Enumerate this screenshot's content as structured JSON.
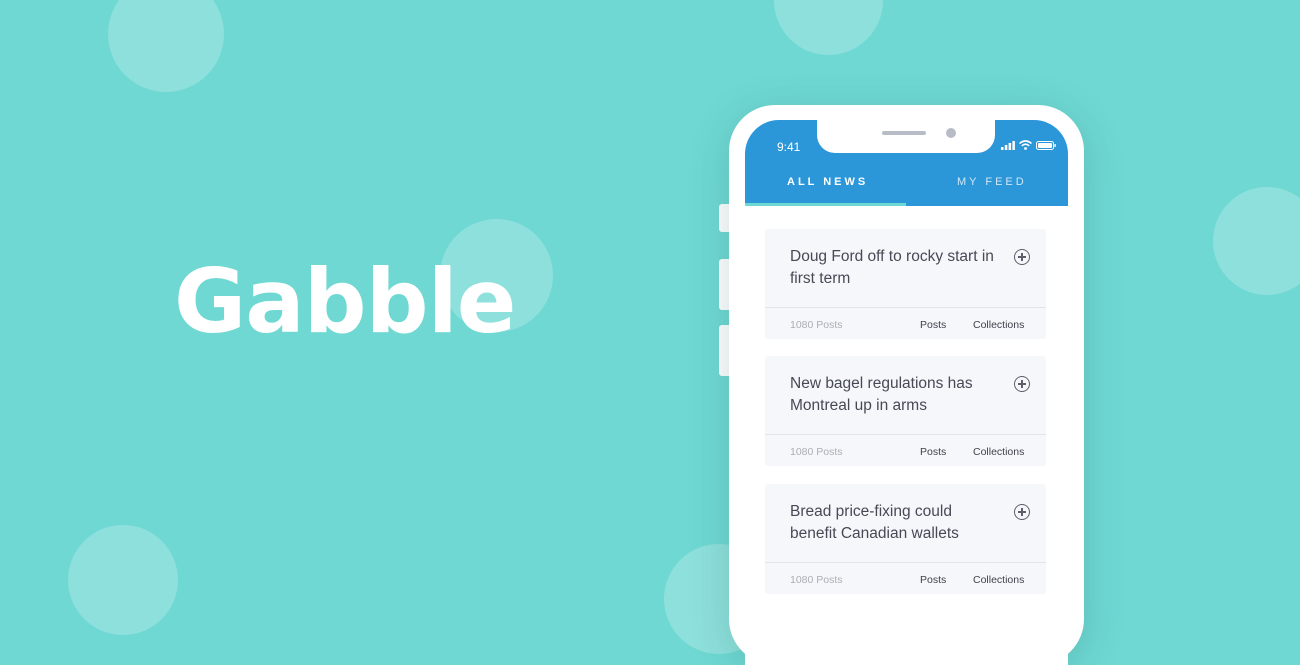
{
  "brand": {
    "name": "Gabble"
  },
  "status_bar": {
    "time": "9:41"
  },
  "tabs": [
    {
      "label": "ALL NEWS",
      "active": true
    },
    {
      "label": "MY FEED",
      "active": false
    }
  ],
  "cards": [
    {
      "title": "Doug Ford off to rocky start in first term",
      "count": "1080 Posts",
      "posts_label": "Posts",
      "collections_label": "Collections"
    },
    {
      "title": "New bagel regulations has Montreal up in arms",
      "count": "1080 Posts",
      "posts_label": "Posts",
      "collections_label": "Collections"
    },
    {
      "title": "Bread price-fixing could benefit Canadian wallets",
      "count": "1080 Posts",
      "posts_label": "Posts",
      "collections_label": "Collections"
    }
  ],
  "colors": {
    "background": "#6fd8d3",
    "app_bar": "#2b97d9",
    "card": "#f6f7fb"
  }
}
